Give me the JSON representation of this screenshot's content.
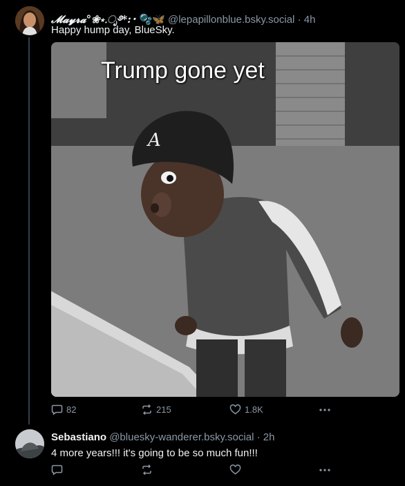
{
  "colors": {
    "background": "#000000",
    "text": "#f1f3f5",
    "muted": "#8b98a5",
    "thread_line": "#2e4052"
  },
  "post1": {
    "display_name": "𝓜𝓪𝔂𝓻𝓪°❀⋆.ೃ࿔*:･",
    "emoji": "🫧🦋",
    "handle": "@lepapillonblue.bsky.social",
    "separator": "·",
    "time": "4h",
    "text": "Happy hump day, BlueSky.",
    "image_caption": "Trump gone yet",
    "image_letter": "A",
    "reply_count": "82",
    "repost_count": "215",
    "like_count": "1.8K"
  },
  "post2": {
    "display_name": "Sebastiano",
    "handle": "@bluesky-wanderer.bsky.social",
    "separator": "·",
    "time": "2h",
    "text": "4 more years!!! it's going to be so much fun!!!"
  },
  "icons": [
    "reply-icon",
    "repost-icon",
    "like-icon",
    "more-icon"
  ]
}
